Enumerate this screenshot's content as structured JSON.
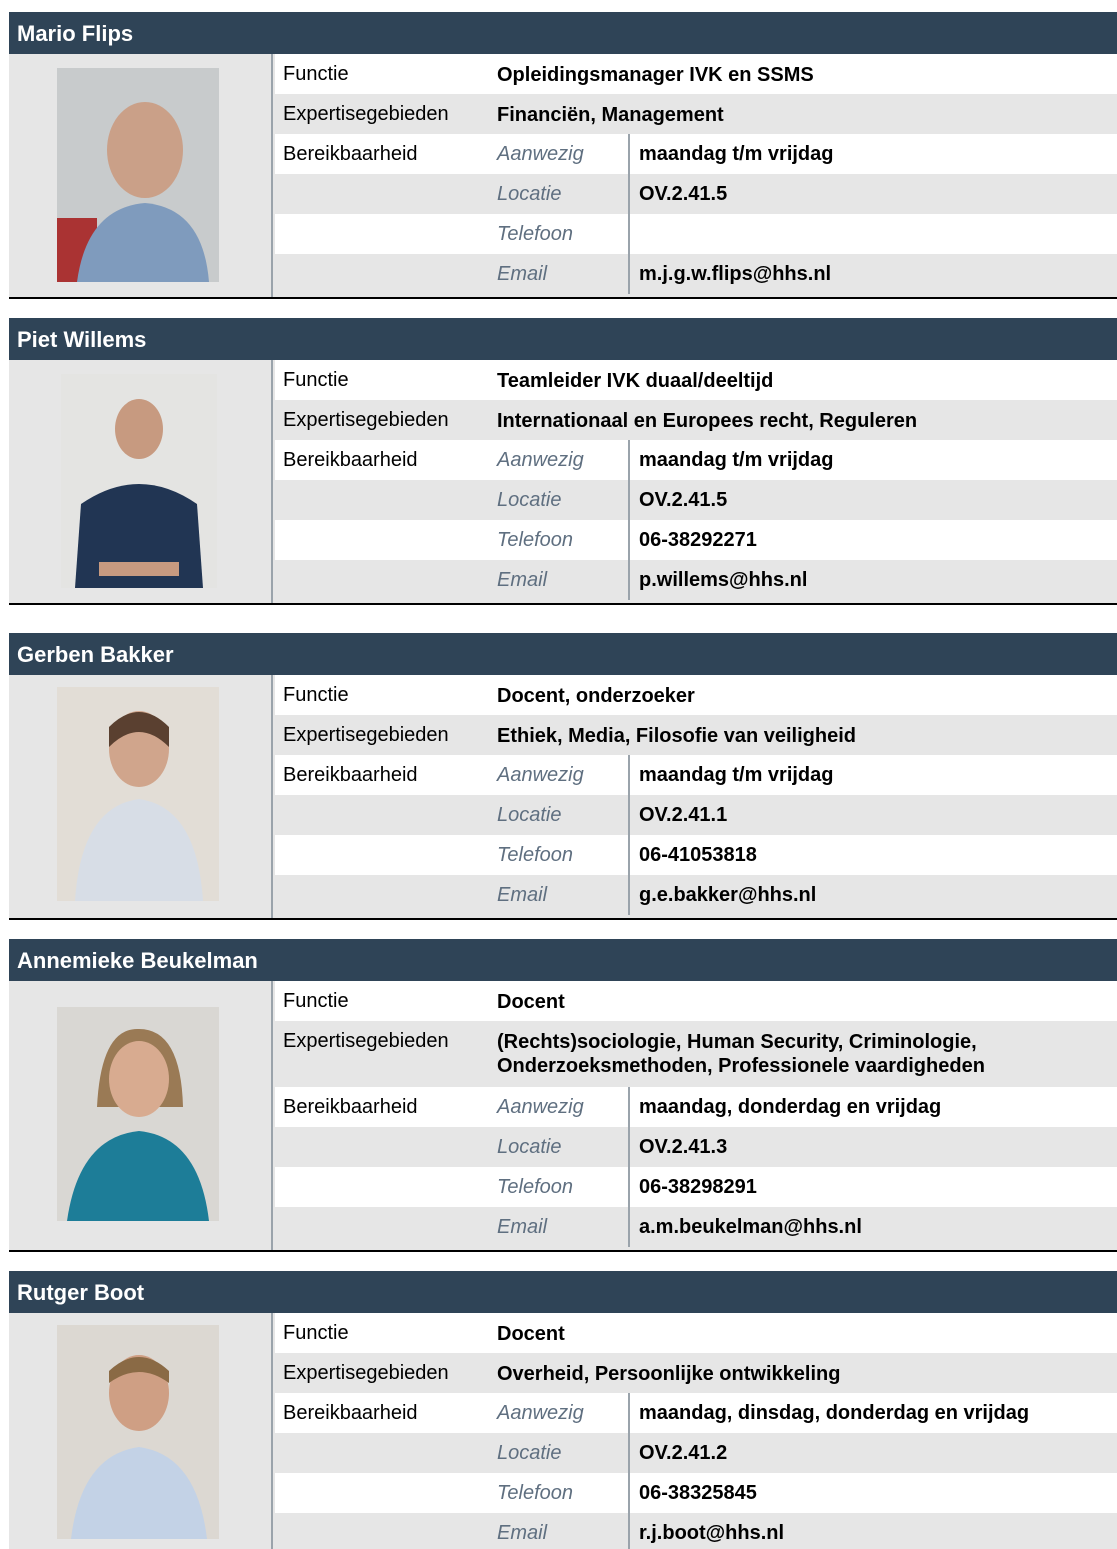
{
  "labels": {
    "functie": "Functie",
    "expertise": "Expertisegebieden",
    "bereik": "Bereikbaarheid",
    "aanwezig": "Aanwezig",
    "locatie": "Locatie",
    "telefoon": "Telefoon",
    "email": "Email"
  },
  "people": [
    {
      "name": "Mario Flips",
      "functie": "Opleidingsmanager IVK en SSMS",
      "expertise": "Financiën, Management",
      "aanwezig": "maandag t/m vrijdag",
      "locatie": "OV.2.41.5",
      "telefoon": "",
      "email": "m.j.g.w.flips@hhs.nl"
    },
    {
      "name": "Piet Willems",
      "functie": "Teamleider IVK duaal/deeltijd",
      "expertise": "Internationaal en Europees recht, Reguleren",
      "aanwezig": "maandag t/m vrijdag",
      "locatie": "OV.2.41.5",
      "telefoon": "06-38292271",
      "email": "p.willems@hhs.nl"
    },
    {
      "name": "Gerben Bakker",
      "functie": "Docent, onderzoeker",
      "expertise": "Ethiek, Media, Filosofie van veiligheid",
      "aanwezig": "maandag t/m vrijdag",
      "locatie": "OV.2.41.1",
      "telefoon": "06-41053818",
      "email": "g.e.bakker@hhs.nl"
    },
    {
      "name": "Annemieke Beukelman",
      "functie": "Docent",
      "expertise_line1": "(Rechts)sociologie, Human Security, Criminologie,",
      "expertise_line2": "Onderzoeksmethoden, Professionele vaardigheden",
      "aanwezig": "maandag, donderdag en vrijdag",
      "locatie": "OV.2.41.3",
      "telefoon": "06-38298291",
      "email": "a.m.beukelman@hhs.nl"
    },
    {
      "name": "Rutger Boot",
      "functie": "Docent",
      "expertise": "Overheid, Persoonlijke ontwikkeling",
      "aanwezig": "maandag, dinsdag, donderdag en vrijdag",
      "locatie": "OV.2.41.2",
      "telefoon": "06-38325845",
      "email": "r.j.boot@hhs.nl"
    }
  ]
}
